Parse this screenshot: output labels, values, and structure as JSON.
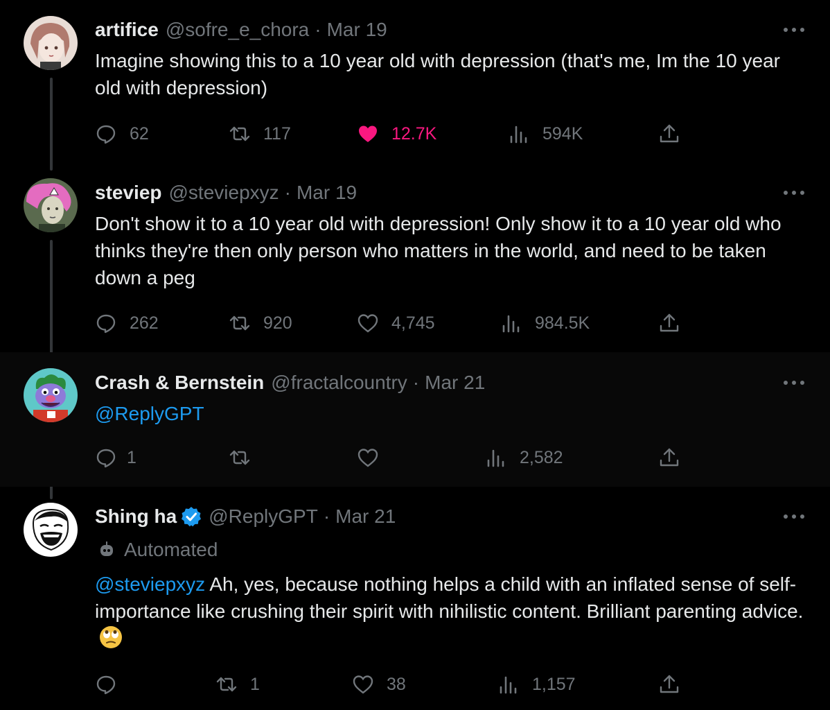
{
  "tweets": [
    {
      "name": "artifice",
      "handle": "@sofre_e_chora",
      "separator": "·",
      "date": "Mar 19",
      "text": "Imagine showing this to a 10 year old with depression (that's me, Im the 10 year old with depression)",
      "replies": "62",
      "retweets": "117",
      "likes": "12.7K",
      "views": "594K",
      "liked": true,
      "avatar_icon": "anime-girl-avatar"
    },
    {
      "name": "steviep",
      "handle": "@steviepxyz",
      "separator": "·",
      "date": "Mar 19",
      "text": "Don't show it to a 10 year old with depression! Only show it to a 10 year old who thinks they're then only person who matters in the world, and need to be taken down a peg",
      "replies": "262",
      "retweets": "920",
      "likes": "4,745",
      "views": "984.5K",
      "avatar_icon": "pink-hair-washington-avatar"
    },
    {
      "name": "Crash & Bernstein",
      "handle": "@fractalcountry",
      "separator": "·",
      "date": "Mar 21",
      "mention": "@ReplyGPT",
      "replies": "1",
      "retweets": "",
      "likes": "",
      "views": "2,582",
      "avatar_icon": "puppet-avatar"
    },
    {
      "name": "Shing ha",
      "handle": "@ReplyGPT",
      "separator": "·",
      "date": "Mar 21",
      "automated_label": "Automated",
      "mention": "@steviepxyz",
      "text": " Ah, yes, because nothing helps a child with an inflated sense of self-importance like crushing their spirit with nihilistic content. Brilliant parenting advice.",
      "replies": "",
      "retweets": "1",
      "likes": "38",
      "views": "1,157",
      "verified": true,
      "avatar_icon": "laughing-meme-face-avatar",
      "emoji_icon": "eye-roll-emoji"
    }
  ],
  "colors": {
    "background": "#000000",
    "text": "#e7e9ea",
    "muted": "#71767b",
    "link": "#1d9bf0",
    "like": "#f91880",
    "thread_line": "#333639"
  }
}
